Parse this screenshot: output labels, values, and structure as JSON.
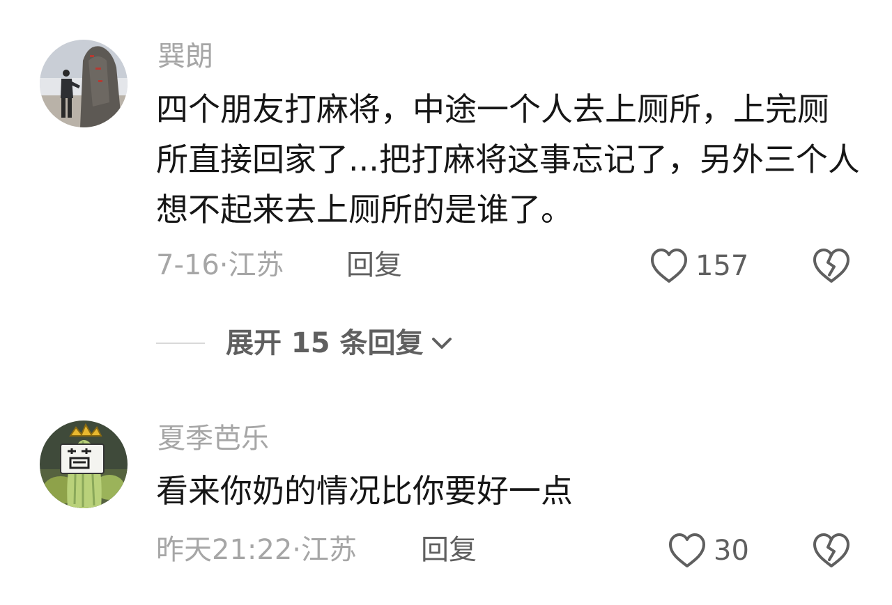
{
  "comments": [
    {
      "username": "巽朗",
      "text": "四个朋友打麻将，中途一个人去上厕所，上完厕所直接回家了...把打麻将这事忘记了，另外三个人想不起来去上厕所的是谁了。",
      "meta": "7-16·江苏",
      "reply_label": "回复",
      "likes": "157",
      "avatar_icon": "person-by-stone-avatar"
    },
    {
      "username": "夏季芭乐",
      "text": "看来你奶的情况比你要好一点",
      "meta": "昨天21:22·江苏",
      "reply_label": "回复",
      "likes": "30",
      "avatar_icon": "cartoon-bitter-melon-avatar"
    }
  ],
  "expand_replies": {
    "label": "展开 15 条回复"
  },
  "colors": {
    "text_primary": "#161616",
    "text_secondary": "#a6a6a6",
    "text_action": "#5f5f5f",
    "icon": "#5f5f5f"
  }
}
